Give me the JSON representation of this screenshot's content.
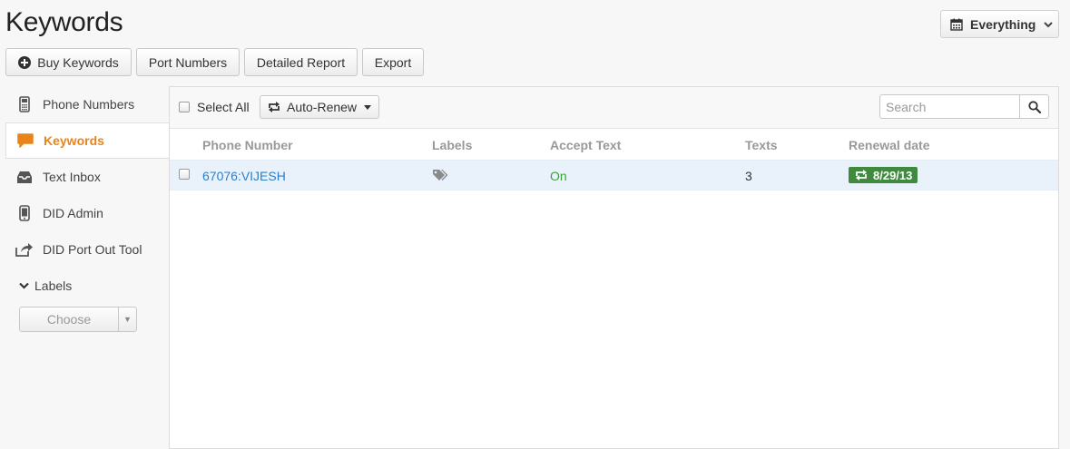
{
  "header": {
    "title": "Keywords",
    "range_label": "Everything"
  },
  "toolbar": {
    "buy_label": "Buy Keywords",
    "port_label": "Port Numbers",
    "report_label": "Detailed Report",
    "export_label": "Export"
  },
  "sidebar": {
    "items": [
      {
        "label": "Phone Numbers",
        "icon": "phone-icon"
      },
      {
        "label": "Keywords",
        "icon": "speech-bubble-icon",
        "active": true
      },
      {
        "label": "Text Inbox",
        "icon": "inbox-icon"
      },
      {
        "label": "DID Admin",
        "icon": "mobile-icon"
      },
      {
        "label": "DID Port Out Tool",
        "icon": "share-icon"
      }
    ],
    "labels_heading": "Labels",
    "choose_placeholder": "Choose"
  },
  "list": {
    "select_all_label": "Select All",
    "auto_renew_label": "Auto-Renew",
    "search_placeholder": "Search",
    "columns": [
      "Phone Number",
      "Labels",
      "Accept Text",
      "Texts",
      "Renewal date"
    ],
    "rows": [
      {
        "phone": "67076:VIJESH",
        "accept_text": "On",
        "texts": "3",
        "renewal_date": "8/29/13"
      }
    ]
  },
  "colors": {
    "accent": "#e8841a",
    "link": "#2a7fc9",
    "status_on": "#3aa13a",
    "renew_badge": "#3f8a3f",
    "selected_row": "#e9f1fb"
  }
}
